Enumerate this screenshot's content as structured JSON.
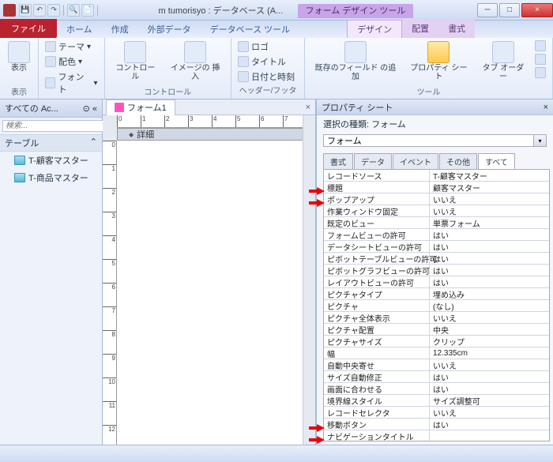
{
  "title": "m tumorisyo : データベース (A...",
  "context_title": "フォーム デザイン ツール",
  "win": {
    "min": "─",
    "max": "□",
    "close": "×"
  },
  "tabs": {
    "file": "ファイル",
    "home": "ホーム",
    "create": "作成",
    "external": "外部データ",
    "dbtools": "データベース ツール"
  },
  "ctx_tabs": {
    "design": "デザイン",
    "arrange": "配置",
    "format": "書式"
  },
  "ribbon": {
    "view_grp": {
      "view": "表示",
      "label": "表示"
    },
    "themes_grp": {
      "themes": "テーマ",
      "colors": "配色",
      "fonts": "フォント",
      "label": "テーマ"
    },
    "controls_grp": {
      "controls": "コントロール",
      "insimg": "イメージの\n挿入",
      "label": "コントロール"
    },
    "hdrftr_grp": {
      "logo": "ロゴ",
      "title": "タイトル",
      "datetime": "日付と時刻",
      "label": "ヘッダー/フッター"
    },
    "tools_grp": {
      "addfield": "既存のフィールド\nの追加",
      "propsheet": "プロパティ\nシート",
      "taborder": "タブ\nオーダー",
      "label": "ツール"
    }
  },
  "nav": {
    "header": "すべての Ac...",
    "search_ph": "検索...",
    "category": "テーブル",
    "items": [
      "T-顧客マスター",
      "T-商品マスター"
    ]
  },
  "form": {
    "tabname": "フォーム1",
    "section": "詳細"
  },
  "prop": {
    "title": "プロパティ シート",
    "subtitle": "選択の種類: フォーム",
    "object": "フォーム",
    "tabs": [
      "書式",
      "データ",
      "イベント",
      "その他",
      "すべて"
    ],
    "rows": [
      {
        "k": "レコードソース",
        "v": "T-顧客マスター"
      },
      {
        "k": "標題",
        "v": "顧客マスター"
      },
      {
        "k": "ポップアップ",
        "v": "いいえ"
      },
      {
        "k": "作業ウィンドウ固定",
        "v": "いいえ"
      },
      {
        "k": "既定のビュー",
        "v": "単票フォーム"
      },
      {
        "k": "フォームビューの許可",
        "v": "はい"
      },
      {
        "k": "データシートビューの許可",
        "v": "はい"
      },
      {
        "k": "ピボットテーブルビューの許可",
        "v": "はい"
      },
      {
        "k": "ピボットグラフビューの許可",
        "v": "はい"
      },
      {
        "k": "レイアウトビューの許可",
        "v": "はい"
      },
      {
        "k": "ピクチャタイプ",
        "v": "埋め込み"
      },
      {
        "k": "ピクチャ",
        "v": "(なし)"
      },
      {
        "k": "ピクチャ全体表示",
        "v": "いいえ"
      },
      {
        "k": "ピクチャ配置",
        "v": "中央"
      },
      {
        "k": "ピクチャサイズ",
        "v": "クリップ"
      },
      {
        "k": "幅",
        "v": "12.335cm"
      },
      {
        "k": "自動中央寄せ",
        "v": "いいえ"
      },
      {
        "k": "サイズ自動修正",
        "v": "はい"
      },
      {
        "k": "画面に合わせる",
        "v": "はい"
      },
      {
        "k": "境界線スタイル",
        "v": "サイズ調整可"
      },
      {
        "k": "レコードセレクタ",
        "v": "いいえ"
      },
      {
        "k": "移動ボタン",
        "v": "はい"
      },
      {
        "k": "ナビゲーションタイトル",
        "v": ""
      }
    ]
  }
}
